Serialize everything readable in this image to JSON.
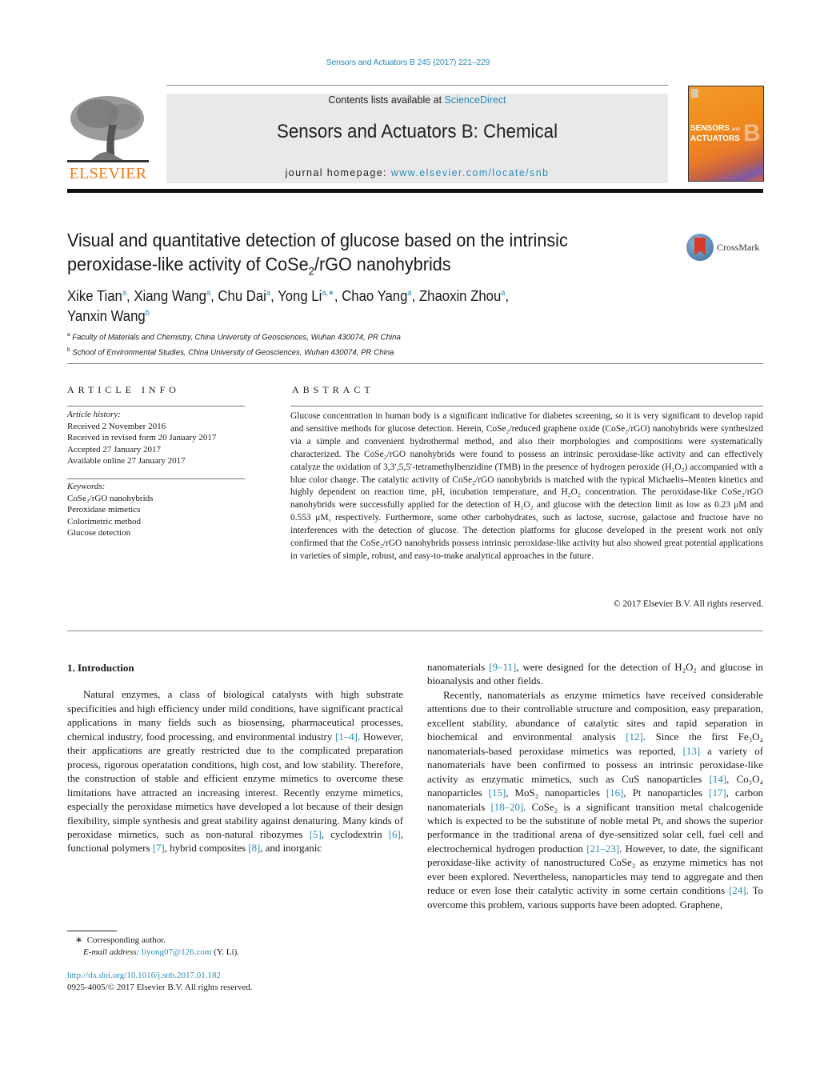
{
  "header": {
    "journal_citation": "Sensors and Actuators B 245 (2017) 221–229",
    "contents_prefix": "Contents lists available at ",
    "contents_link": "ScienceDirect",
    "journal_title": "Sensors and Actuators B: Chemical",
    "homepage_prefix": "journal homepage: ",
    "homepage_link": "www.elsevier.com/locate/snb",
    "publisher_logo_text": "ELSEVIER",
    "cover_line1": "SENSORS",
    "cover_and": "and",
    "cover_line2": "ACTUATORS",
    "cover_letter": "B",
    "crossmark_label": "CrossMark"
  },
  "article": {
    "title_part1": "Visual and quantitative detection of glucose based on the intrinsic peroxidase-like activity of CoSe",
    "title_sub": "2",
    "title_part2": "/rGO nanohybrids",
    "authors": [
      {
        "name": "Xike Tian",
        "aff": "a"
      },
      {
        "name": "Xiang Wang",
        "aff": "a"
      },
      {
        "name": "Chu Dai",
        "aff": "a"
      },
      {
        "name": "Yong Li",
        "aff": "a,∗"
      },
      {
        "name": "Chao Yang",
        "aff": "a"
      },
      {
        "name": "Zhaoxin Zhou",
        "aff": "a"
      },
      {
        "name": "Yanxin Wang",
        "aff": "b"
      }
    ],
    "affiliations": [
      {
        "key": "a",
        "text": "Faculty of Materials and Chemistry, China University of Geosciences, Wuhan 430074, PR China"
      },
      {
        "key": "b",
        "text": "School of Environmental Studies, China University of Geosciences, Wuhan 430074, PR China"
      }
    ]
  },
  "article_info": {
    "heading": "ARTICLE INFO",
    "history_label": "Article history:",
    "history": [
      "Received 2 November 2016",
      "Received in revised form 20 January 2017",
      "Accepted 27 January 2017",
      "Available online 27 January 2017"
    ],
    "keywords_label": "Keywords:",
    "keywords": [
      "CoSe₂/rGO nanohybrids",
      "Peroxidase mimetics",
      "Colorimetric method",
      "Glucose detection"
    ]
  },
  "abstract": {
    "heading": "ABSTRACT",
    "text": "Glucose concentration in human body is a significant indicative for diabetes screening, so it is very significant to develop rapid and sensitive methods for glucose detection. Herein, CoSe₂/reduced graphene oxide (CoSe₂/rGO) nanohybrids were synthesized via a simple and convenient hydrothermal method, and also their morphologies and compositions were systematically characterized. The CoSe₂/rGO nanohybrids were found to possess an intrinsic peroxidase-like activity and can effectively catalyze the oxidation of 3,3′,5,5′-tetramethylbenzidine (TMB) in the presence of hydrogen peroxide (H₂O₂) accompanied with a blue color change. The catalytic activity of CoSe₂/rGO nanohybrids is matched with the typical Michaelis–Menten kinetics and highly dependent on reaction time, pH, incubation temperature, and H₂O₂ concentration. The peroxidase-like CoSe₂/rGO nanohybrids were successfully applied for the detection of H₂O₂ and glucose with the detection limit as low as 0.23 μM and 0.553 μM, respectively. Furthermore, some other carbohydrates, such as lactose, sucrose, galactose and fructose have no interferences with the detection of glucose. The detection platforms for glucose developed in the present work not only confirmed that the CoSe₂/rGO nanohybrids possess intrinsic peroxidase-like activity but also showed great potential applications in varieties of simple, robust, and easy-to-make analytical approaches in the future.",
    "copyright": "© 2017 Elsevier B.V. All rights reserved."
  },
  "body": {
    "section_heading": "1.  Introduction",
    "left_paragraph": [
      {
        "t": "Natural enzymes, a class of biological catalysts with high substrate specificities and high efficiency under mild conditions, have significant practical applications in many fields such as biosensing, pharmaceutical processes, chemical industry, food processing, and environmental industry "
      },
      {
        "ref": "[1–4]"
      },
      {
        "t": ". However, their applications are greatly restricted due to the complicated preparation process, rigorous operatation conditions, high cost, and low stability. Therefore, the construction of stable and efficient enzyme mimetics to overcome these limitations have attracted an increasing interest. Recently enzyme mimetics, especially the peroxidase mimetics have developed a lot because of their design flexibility, simple synthesis and great stability against denaturing. Many kinds of peroxidase mimetics, such as non-natural ribozymes "
      },
      {
        "ref": "[5]"
      },
      {
        "t": ", cyclodextrin "
      },
      {
        "ref": "[6]"
      },
      {
        "t": ", functional polymers "
      },
      {
        "ref": "[7]"
      },
      {
        "t": ", hybrid composites "
      },
      {
        "ref": "[8]"
      },
      {
        "t": ", and inorganic"
      }
    ],
    "right_paragraph_1": [
      {
        "t": "nanomaterials "
      },
      {
        "ref": "[9–11]"
      },
      {
        "t": ", were designed for the detection of H₂O₂ and glucose in bioanalysis and other fields."
      }
    ],
    "right_paragraph_2": [
      {
        "t": "Recently, nanomaterials as enzyme mimetics have received considerable attentions due to their controllable structure and composition, easy preparation, excellent stability, abundance of catalytic sites and rapid separation in biochemical and environmental analysis "
      },
      {
        "ref": "[12]"
      },
      {
        "t": ". Since the first Fe₃O₄ nanomaterials-based peroxidase mimetics was reported, "
      },
      {
        "ref": "[13]"
      },
      {
        "t": " a variety of nanomaterials have been confirmed to possess an intrinsic peroxidase-like activity as enzymatic mimetics, such as CuS nanoparticles "
      },
      {
        "ref": "[14]"
      },
      {
        "t": ", Co₃O₄ nanoparticles "
      },
      {
        "ref": "[15]"
      },
      {
        "t": ", MoS₂ nanoparticles "
      },
      {
        "ref": "[16]"
      },
      {
        "t": ", Pt nanoparticles "
      },
      {
        "ref": "[17]"
      },
      {
        "t": ", carbon nanomaterials "
      },
      {
        "ref": "[18–20]"
      },
      {
        "t": ". CoSe₂ is a significant transition metal chalcogenide which is expected to be the substitute of noble metal Pt, and shows the superior performance in the traditional arena of dye-sensitized solar cell, fuel cell and electrochemical hydrogen production "
      },
      {
        "ref": "[21–23]"
      },
      {
        "t": ". However, to date, the significant peroxidase-like activity of nanostructured CoSe₂ as enzyme mimetics has not ever been explored. Nevertheless, nanoparticles may tend to aggregate and then reduce or even lose their catalytic activity in some certain conditions "
      },
      {
        "ref": "[24]"
      },
      {
        "t": ". To overcome this problem, various supports have been adopted. Graphene,"
      }
    ]
  },
  "footnotes": {
    "marker": "∗",
    "corresponding": "Corresponding author.",
    "email_label": "E-mail address:",
    "email": "liyong07@126.com",
    "email_suffix": " (Y. Li).",
    "doi": "http://dx.doi.org/10.1016/j.snb.2017.01.182",
    "issn_line": "0925-4005/© 2017 Elsevier B.V. All rights reserved."
  },
  "colors": {
    "link": "#2b8ab8",
    "elsevier_orange": "#f07c16",
    "header_band": "#e9e9e9"
  }
}
